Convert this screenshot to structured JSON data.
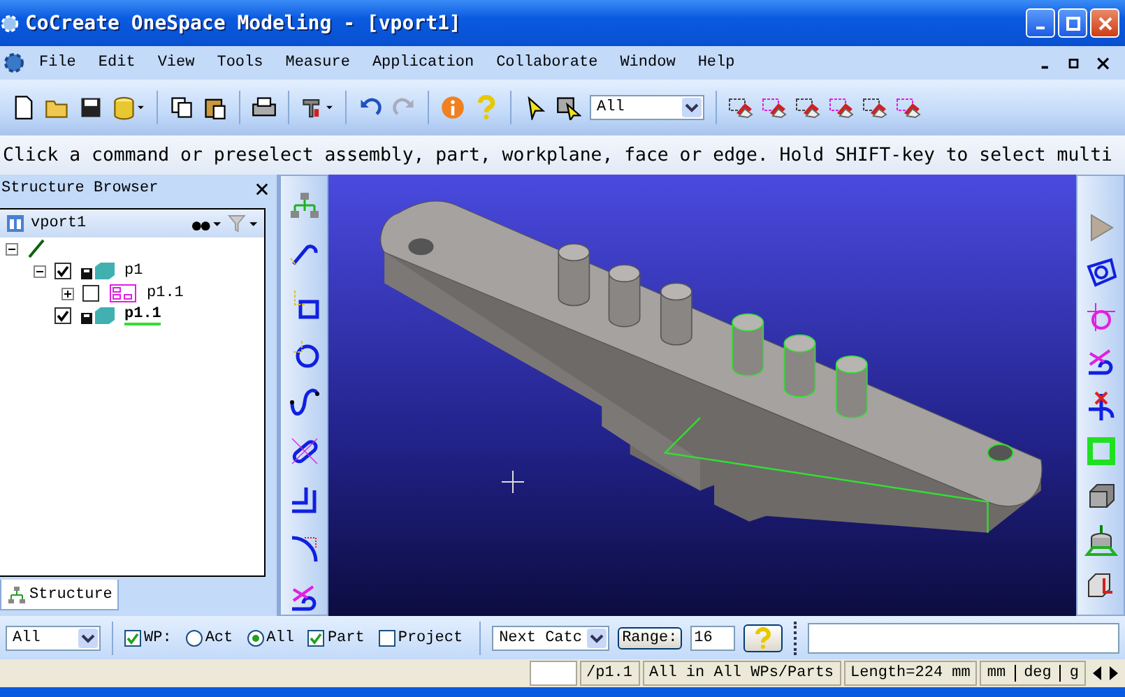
{
  "window": {
    "title": "CoCreate OneSpace Modeling - [vport1]"
  },
  "menu": [
    "File",
    "Edit",
    "View",
    "Tools",
    "Measure",
    "Application",
    "Collaborate",
    "Window",
    "Help"
  ],
  "toolbar": {
    "filter_value": "All"
  },
  "prompt": "Click a command or preselect assembly, part, workplane, face or edge. Hold SHIFT-key to select multi",
  "structure_browser": {
    "title": "Structure Browser",
    "root": "vport1",
    "tree": [
      {
        "kind": "line",
        "expanded": true,
        "children": [
          {
            "kind": "part",
            "label": "p1",
            "checked": true,
            "expanded": true,
            "current": false,
            "children": [
              {
                "kind": "workplane",
                "label": "p1.1",
                "checked": false,
                "expanded": false,
                "current": false
              }
            ]
          },
          {
            "kind": "part",
            "label": "p1.1",
            "checked": true,
            "current": true
          }
        ]
      }
    ],
    "tabs": [
      {
        "label": "Structure",
        "selected": true
      }
    ]
  },
  "bottom_bar": {
    "selection_filter": "All",
    "options": [
      {
        "kind": "checkbox",
        "label": "WP:",
        "checked": true
      },
      {
        "kind": "radio",
        "label": "Act",
        "selected": false
      },
      {
        "kind": "radio",
        "label": "All",
        "selected": true
      },
      {
        "kind": "checkbox",
        "label": "Part",
        "checked": true
      },
      {
        "kind": "checkbox",
        "label": "Project",
        "checked": false
      }
    ],
    "catch_mode": "Next Catc",
    "range_label": "Range:",
    "range_value": "16"
  },
  "status_bar": {
    "path": "/p1.1",
    "scope": "All in All WPs/Parts",
    "measure": "Length=224 mm",
    "units": [
      "mm",
      "deg",
      "g"
    ]
  }
}
